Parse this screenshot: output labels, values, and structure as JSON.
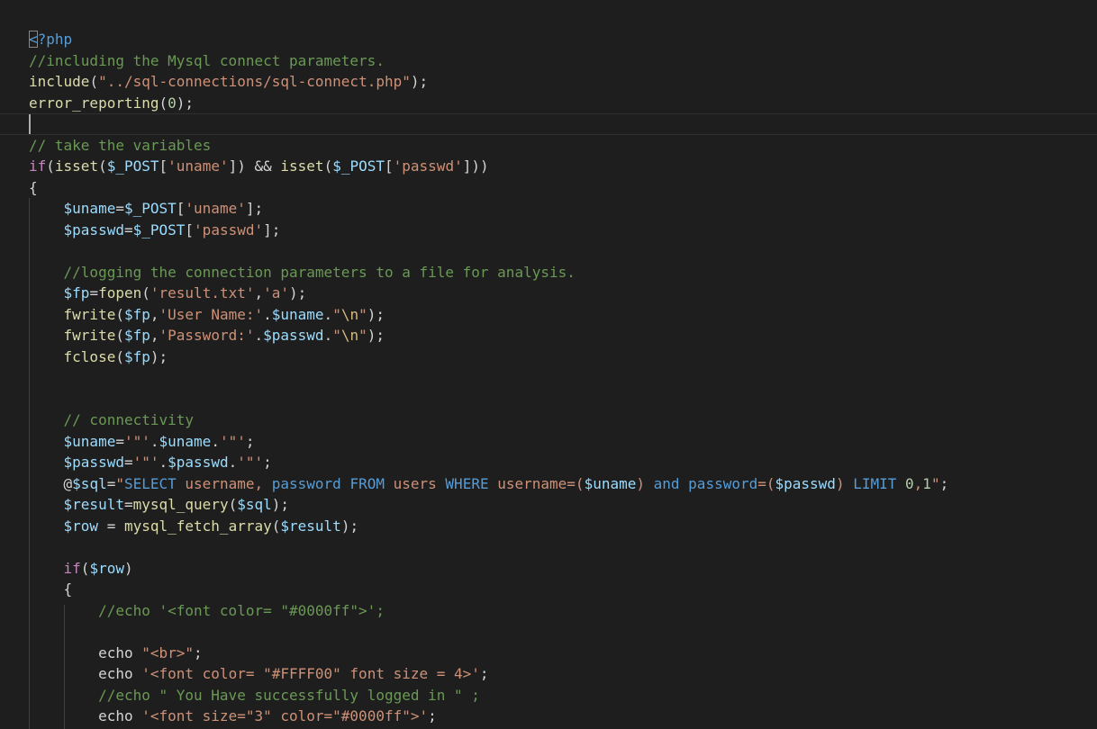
{
  "editor": {
    "language": "php",
    "theme_colors": {
      "background": "#1e1e1e",
      "comment": "#6a9955",
      "function": "#dcdcaa",
      "string": "#ce9178",
      "variable": "#9cdcfe",
      "keyword": "#c586c0",
      "tag": "#569cd6",
      "number": "#b5cea8",
      "plain": "#d4d4d4"
    },
    "cursor_line": 4,
    "lines": [
      [
        {
          "c": "tag-open",
          "t": "<"
        },
        {
          "c": "tag",
          "t": "?php"
        }
      ],
      [
        {
          "c": "cmt",
          "t": "//including the Mysql connect parameters."
        }
      ],
      [
        {
          "c": "fn",
          "t": "include"
        },
        {
          "c": "plain",
          "t": "("
        },
        {
          "c": "str",
          "t": "\"../sql-connections/sql-connect.php\""
        },
        {
          "c": "plain",
          "t": ");"
        }
      ],
      [
        {
          "c": "fn",
          "t": "error_reporting"
        },
        {
          "c": "plain",
          "t": "("
        },
        {
          "c": "num",
          "t": "0"
        },
        {
          "c": "plain",
          "t": ");"
        }
      ],
      [],
      [
        {
          "c": "cmt",
          "t": "// take the variables"
        }
      ],
      [
        {
          "c": "kw",
          "t": "if"
        },
        {
          "c": "plain",
          "t": "("
        },
        {
          "c": "fn",
          "t": "isset"
        },
        {
          "c": "plain",
          "t": "("
        },
        {
          "c": "var",
          "t": "$_POST"
        },
        {
          "c": "plain",
          "t": "["
        },
        {
          "c": "str",
          "t": "'uname'"
        },
        {
          "c": "plain",
          "t": "]) && "
        },
        {
          "c": "fn",
          "t": "isset"
        },
        {
          "c": "plain",
          "t": "("
        },
        {
          "c": "var",
          "t": "$_POST"
        },
        {
          "c": "plain",
          "t": "["
        },
        {
          "c": "str",
          "t": "'passwd'"
        },
        {
          "c": "plain",
          "t": "]))"
        }
      ],
      [
        {
          "c": "plain",
          "t": "{"
        }
      ],
      [
        {
          "c": "plain",
          "t": "    "
        },
        {
          "c": "var",
          "t": "$uname"
        },
        {
          "c": "plain",
          "t": "="
        },
        {
          "c": "var",
          "t": "$_POST"
        },
        {
          "c": "plain",
          "t": "["
        },
        {
          "c": "str",
          "t": "'uname'"
        },
        {
          "c": "plain",
          "t": "];"
        }
      ],
      [
        {
          "c": "plain",
          "t": "    "
        },
        {
          "c": "var",
          "t": "$passwd"
        },
        {
          "c": "plain",
          "t": "="
        },
        {
          "c": "var",
          "t": "$_POST"
        },
        {
          "c": "plain",
          "t": "["
        },
        {
          "c": "str",
          "t": "'passwd'"
        },
        {
          "c": "plain",
          "t": "];"
        }
      ],
      [],
      [
        {
          "c": "plain",
          "t": "    "
        },
        {
          "c": "cmt",
          "t": "//logging the connection parameters to a file for analysis."
        }
      ],
      [
        {
          "c": "plain",
          "t": "    "
        },
        {
          "c": "var",
          "t": "$fp"
        },
        {
          "c": "plain",
          "t": "="
        },
        {
          "c": "fn",
          "t": "fopen"
        },
        {
          "c": "plain",
          "t": "("
        },
        {
          "c": "str",
          "t": "'result.txt'"
        },
        {
          "c": "plain",
          "t": ","
        },
        {
          "c": "str",
          "t": "'a'"
        },
        {
          "c": "plain",
          "t": ");"
        }
      ],
      [
        {
          "c": "plain",
          "t": "    "
        },
        {
          "c": "fn",
          "t": "fwrite"
        },
        {
          "c": "plain",
          "t": "("
        },
        {
          "c": "var",
          "t": "$fp"
        },
        {
          "c": "plain",
          "t": ","
        },
        {
          "c": "str",
          "t": "'User Name:'"
        },
        {
          "c": "plain",
          "t": "."
        },
        {
          "c": "var",
          "t": "$uname"
        },
        {
          "c": "plain",
          "t": "."
        },
        {
          "c": "str",
          "t": "\""
        },
        {
          "c": "esc",
          "t": "\\n"
        },
        {
          "c": "str",
          "t": "\""
        },
        {
          "c": "plain",
          "t": ");"
        }
      ],
      [
        {
          "c": "plain",
          "t": "    "
        },
        {
          "c": "fn",
          "t": "fwrite"
        },
        {
          "c": "plain",
          "t": "("
        },
        {
          "c": "var",
          "t": "$fp"
        },
        {
          "c": "plain",
          "t": ","
        },
        {
          "c": "str",
          "t": "'Password:'"
        },
        {
          "c": "plain",
          "t": "."
        },
        {
          "c": "var",
          "t": "$passwd"
        },
        {
          "c": "plain",
          "t": "."
        },
        {
          "c": "str",
          "t": "\""
        },
        {
          "c": "esc",
          "t": "\\n"
        },
        {
          "c": "str",
          "t": "\""
        },
        {
          "c": "plain",
          "t": ");"
        }
      ],
      [
        {
          "c": "plain",
          "t": "    "
        },
        {
          "c": "fn",
          "t": "fclose"
        },
        {
          "c": "plain",
          "t": "("
        },
        {
          "c": "var",
          "t": "$fp"
        },
        {
          "c": "plain",
          "t": ");"
        }
      ],
      [],
      [],
      [
        {
          "c": "plain",
          "t": "    "
        },
        {
          "c": "cmt",
          "t": "// connectivity"
        }
      ],
      [
        {
          "c": "plain",
          "t": "    "
        },
        {
          "c": "var",
          "t": "$uname"
        },
        {
          "c": "plain",
          "t": "="
        },
        {
          "c": "str",
          "t": "'\"'"
        },
        {
          "c": "plain",
          "t": "."
        },
        {
          "c": "var",
          "t": "$uname"
        },
        {
          "c": "plain",
          "t": "."
        },
        {
          "c": "str",
          "t": "'\"'"
        },
        {
          "c": "plain",
          "t": ";"
        }
      ],
      [
        {
          "c": "plain",
          "t": "    "
        },
        {
          "c": "var",
          "t": "$passwd"
        },
        {
          "c": "plain",
          "t": "="
        },
        {
          "c": "str",
          "t": "'\"'"
        },
        {
          "c": "plain",
          "t": "."
        },
        {
          "c": "var",
          "t": "$passwd"
        },
        {
          "c": "plain",
          "t": "."
        },
        {
          "c": "str",
          "t": "'\"'"
        },
        {
          "c": "plain",
          "t": ";"
        }
      ],
      [
        {
          "c": "plain",
          "t": "    @"
        },
        {
          "c": "var",
          "t": "$sql"
        },
        {
          "c": "plain",
          "t": "="
        },
        {
          "c": "str",
          "t": "\""
        },
        {
          "c": "sql",
          "t": "SELECT"
        },
        {
          "c": "str",
          "t": " username, "
        },
        {
          "c": "sql",
          "t": "password"
        },
        {
          "c": "str",
          "t": " "
        },
        {
          "c": "sql",
          "t": "FROM"
        },
        {
          "c": "str",
          "t": " users "
        },
        {
          "c": "sql",
          "t": "WHERE"
        },
        {
          "c": "str",
          "t": " username=("
        },
        {
          "c": "var",
          "t": "$uname"
        },
        {
          "c": "str",
          "t": ") "
        },
        {
          "c": "sql",
          "t": "and"
        },
        {
          "c": "str",
          "t": " "
        },
        {
          "c": "sql",
          "t": "password"
        },
        {
          "c": "str",
          "t": "=("
        },
        {
          "c": "var",
          "t": "$passwd"
        },
        {
          "c": "str",
          "t": ") "
        },
        {
          "c": "sql",
          "t": "LIMIT"
        },
        {
          "c": "str",
          "t": " "
        },
        {
          "c": "num",
          "t": "0"
        },
        {
          "c": "str",
          "t": ","
        },
        {
          "c": "num",
          "t": "1"
        },
        {
          "c": "str",
          "t": "\""
        },
        {
          "c": "plain",
          "t": ";"
        }
      ],
      [
        {
          "c": "plain",
          "t": "    "
        },
        {
          "c": "var",
          "t": "$result"
        },
        {
          "c": "plain",
          "t": "="
        },
        {
          "c": "fn",
          "t": "mysql_query"
        },
        {
          "c": "plain",
          "t": "("
        },
        {
          "c": "var",
          "t": "$sql"
        },
        {
          "c": "plain",
          "t": ");"
        }
      ],
      [
        {
          "c": "plain",
          "t": "    "
        },
        {
          "c": "var",
          "t": "$row"
        },
        {
          "c": "plain",
          "t": " = "
        },
        {
          "c": "fn",
          "t": "mysql_fetch_array"
        },
        {
          "c": "plain",
          "t": "("
        },
        {
          "c": "var",
          "t": "$result"
        },
        {
          "c": "plain",
          "t": ");"
        }
      ],
      [],
      [
        {
          "c": "plain",
          "t": "    "
        },
        {
          "c": "kw",
          "t": "if"
        },
        {
          "c": "plain",
          "t": "("
        },
        {
          "c": "var",
          "t": "$row"
        },
        {
          "c": "plain",
          "t": ")"
        }
      ],
      [
        {
          "c": "plain",
          "t": "    {"
        }
      ],
      [
        {
          "c": "plain",
          "t": "        "
        },
        {
          "c": "cmt",
          "t": "//echo '<font color= \"#0000ff\">';"
        }
      ],
      [],
      [
        {
          "c": "plain",
          "t": "        echo "
        },
        {
          "c": "str",
          "t": "\"<br>\""
        },
        {
          "c": "plain",
          "t": ";"
        }
      ],
      [
        {
          "c": "plain",
          "t": "        echo "
        },
        {
          "c": "str",
          "t": "'<font color= \"#FFFF00\" font size = 4>'"
        },
        {
          "c": "plain",
          "t": ";"
        }
      ],
      [
        {
          "c": "plain",
          "t": "        "
        },
        {
          "c": "cmt",
          "t": "//echo \" You Have successfully logged in \" ;"
        }
      ],
      [
        {
          "c": "plain",
          "t": "        echo "
        },
        {
          "c": "str",
          "t": "'<font size=\"3\" color=\"#0000ff\">'"
        },
        {
          "c": "plain",
          "t": ";"
        }
      ]
    ]
  }
}
